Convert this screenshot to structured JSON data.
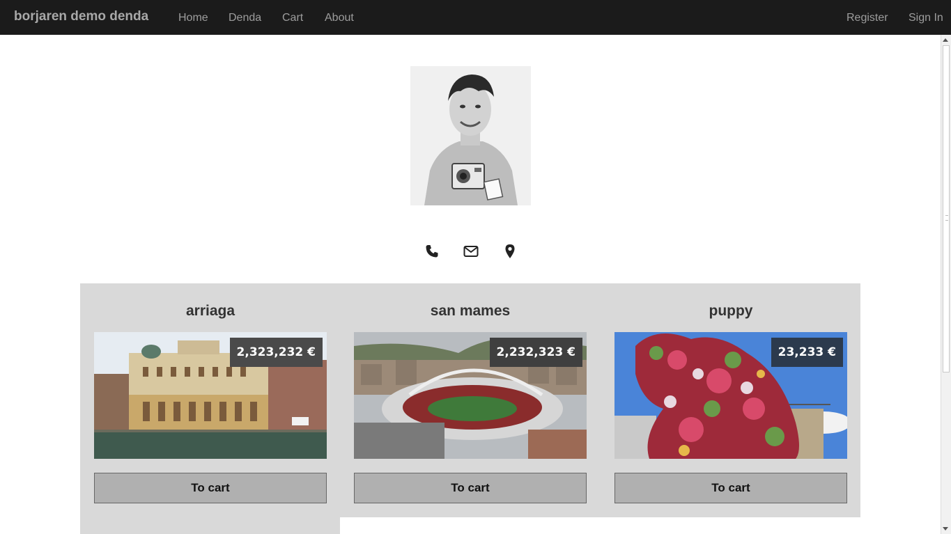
{
  "navbar": {
    "brand": "borjaren demo denda",
    "links": [
      "Home",
      "Denda",
      "Cart",
      "About"
    ],
    "right_links": [
      "Register",
      "Sign In"
    ]
  },
  "profile": {
    "photo_icon": "profile-photo",
    "contact_icons": [
      "phone-icon",
      "envelope-icon",
      "map-marker-icon"
    ]
  },
  "products": [
    {
      "title": "arriaga",
      "price": "2,323,232 €",
      "button": "To cart",
      "badge_color": "#4a4a4a"
    },
    {
      "title": "san mames",
      "price": "2,232,323 €",
      "button": "To cart",
      "badge_color": "#3f3f3f"
    },
    {
      "title": "puppy",
      "price": "23,233 €",
      "button": "To cart",
      "badge_color": "#2c3a4d"
    }
  ],
  "colors": {
    "navbar_bg": "#1b1b1b",
    "nav_text": "#9d9d9d",
    "products_bg": "#d9d9d9",
    "button_bg": "#b0b0b0"
  }
}
